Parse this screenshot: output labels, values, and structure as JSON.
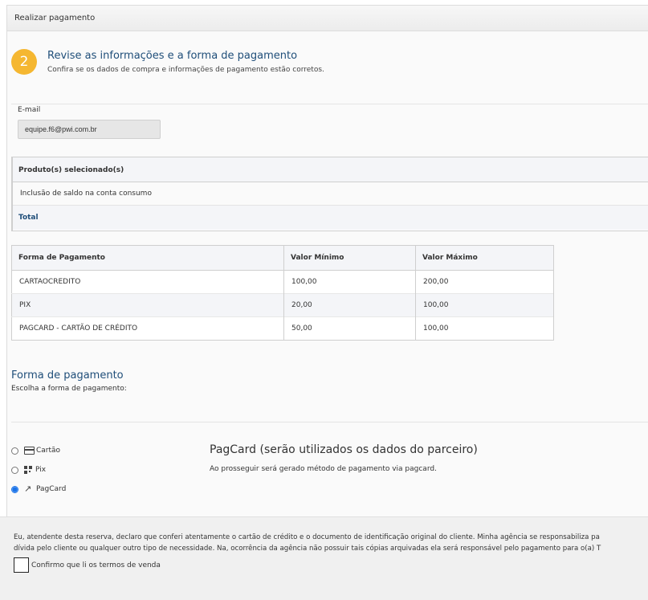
{
  "header": {
    "title": "Realizar pagamento"
  },
  "step": {
    "number": "2",
    "title": "Revise as informações e a forma de pagamento",
    "subtitle": "Confira se os dados de compra e informações de pagamento estão corretos."
  },
  "email": {
    "label": "E-mail",
    "value": "equipe.f6@pwi.com.br"
  },
  "products": {
    "header": "Produto(s) selecionado(s)",
    "items": [
      "Inclusão de saldo na conta consumo"
    ],
    "total_label": "Total"
  },
  "payment_table": {
    "columns": [
      "Forma de Pagamento",
      "Valor Mínimo",
      "Valor Máximo"
    ],
    "rows": [
      [
        "CARTAOCREDITO",
        "100,00",
        "200,00"
      ],
      [
        "PIX",
        "20,00",
        "100,00"
      ],
      [
        "PAGCARD - CARTÃO DE CRÉDITO",
        "50,00",
        "100,00"
      ]
    ]
  },
  "payment_method": {
    "title": "Forma de pagamento",
    "subtitle": "Escolha a forma de pagamento:",
    "options": [
      {
        "label": "Cartão",
        "icon": "credit-card-icon",
        "selected": false
      },
      {
        "label": "Pix",
        "icon": "qr-code-icon",
        "selected": false
      },
      {
        "label": "PagCard",
        "icon": "external-link-icon",
        "selected": true
      }
    ],
    "pagcard_title": "PagCard (serão utilizados os dados do parceiro)",
    "pagcard_desc": "Ao prosseguir será gerado método de pagamento via pagcard."
  },
  "terms": {
    "line1": "Eu, atendente desta reserva, declaro que conferi atentamente o cartão de crédito e o documento de identificação original do cliente. Minha agência se responsabiliza pa",
    "line2": "dívida pelo cliente ou qualquer outro tipo de necessidade. Na, ocorrência da agência não possuir tais cópias arquivadas ela será responsável pelo pagamento para o(a) T",
    "confirm_label": "Confirmo que li os termos de venda"
  }
}
